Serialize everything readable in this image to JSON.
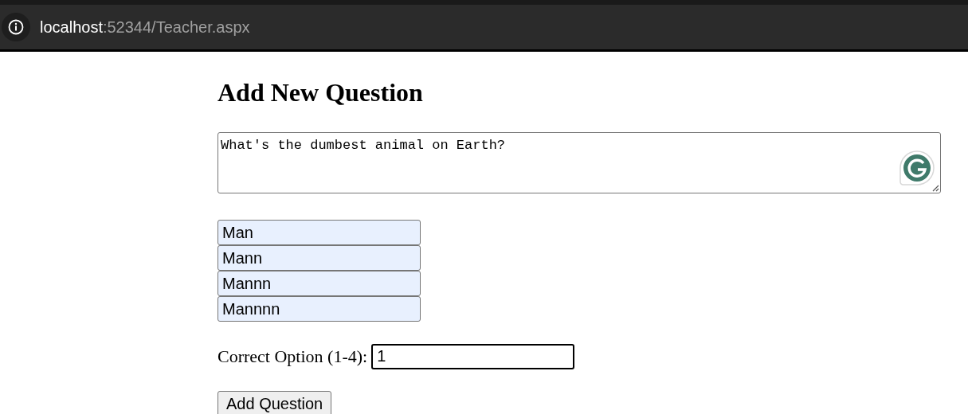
{
  "address_bar": {
    "host": "localhost",
    "path": ":52344/Teacher.aspx"
  },
  "heading": "Add New Question",
  "question": {
    "value": "What's the dumbest animal on Earth?"
  },
  "options": [
    {
      "value": "Man"
    },
    {
      "value": "Mann"
    },
    {
      "value": "Mannn"
    },
    {
      "value": "Mannnn"
    }
  ],
  "correct_option": {
    "label": "Correct Option (1-4):",
    "value": "1",
    "focused": true
  },
  "submit_button": "Add Question"
}
